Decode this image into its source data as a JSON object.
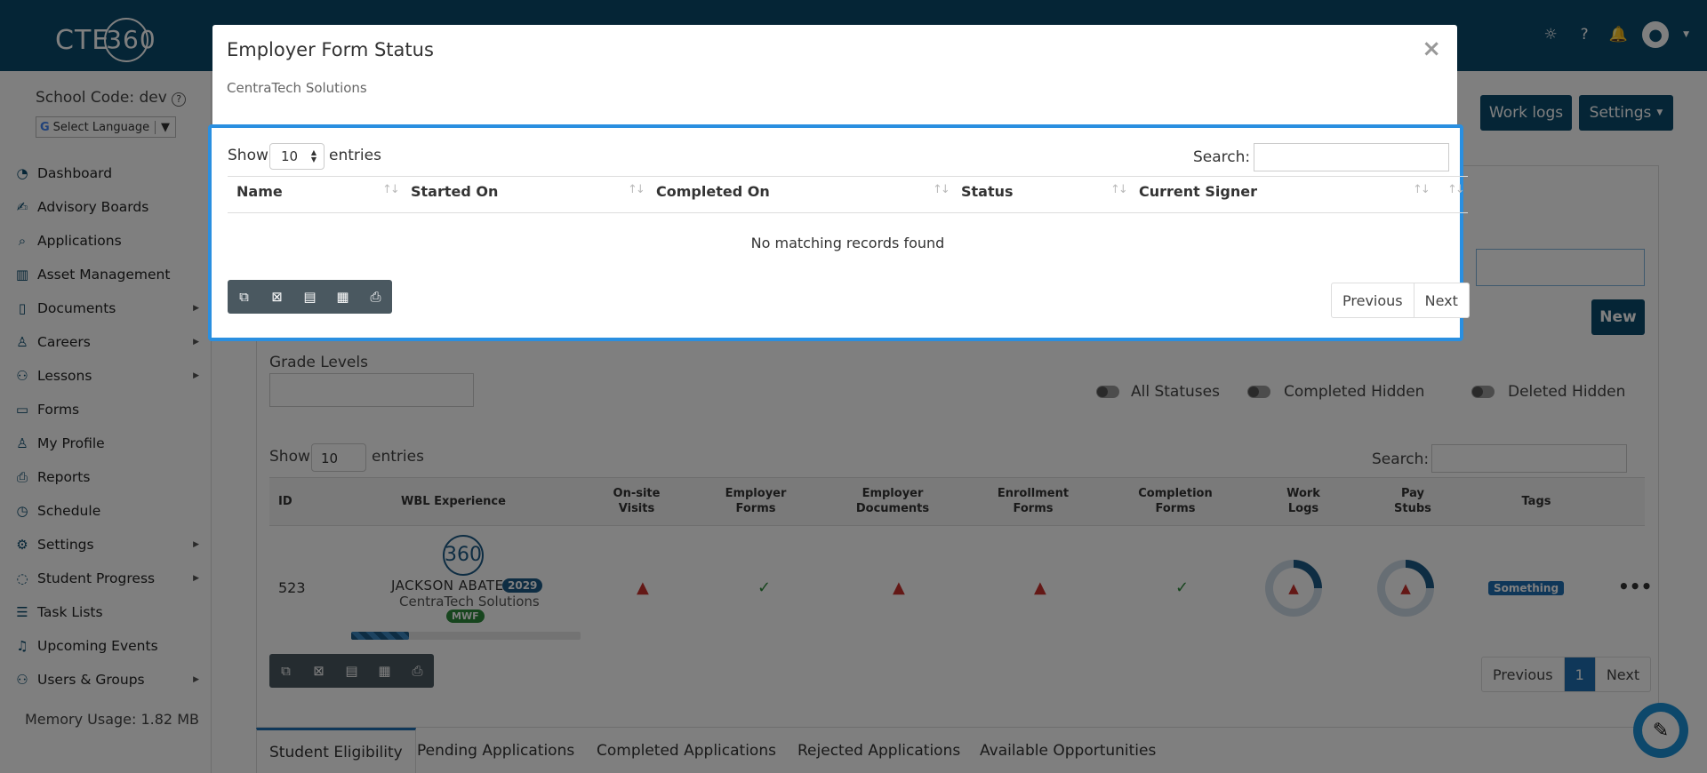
{
  "app": {
    "logo_text": "CTE",
    "logo_ring": "360",
    "header_icons": [
      "lightbulb-icon",
      "help-icon",
      "bell-icon",
      "user-avatar-icon"
    ]
  },
  "sidebar": {
    "school_code": "School Code: dev",
    "language_label": "Select Language",
    "items": [
      {
        "label": "Dashboard",
        "icon": "dashboard-icon",
        "submenu": false
      },
      {
        "label": "Advisory Boards",
        "icon": "handshake-icon",
        "submenu": false
      },
      {
        "label": "Applications",
        "icon": "search-doc-icon",
        "submenu": false
      },
      {
        "label": "Asset Management",
        "icon": "asset-icon",
        "submenu": false
      },
      {
        "label": "Documents",
        "icon": "document-icon",
        "submenu": true
      },
      {
        "label": "Careers",
        "icon": "person-icon",
        "submenu": true
      },
      {
        "label": "Lessons",
        "icon": "people-icon",
        "submenu": true
      },
      {
        "label": "Forms",
        "icon": "form-icon",
        "submenu": false
      },
      {
        "label": "My Profile",
        "icon": "profile-icon",
        "submenu": false
      },
      {
        "label": "Reports",
        "icon": "print-icon",
        "submenu": false
      },
      {
        "label": "Schedule",
        "icon": "clock-icon",
        "submenu": false
      },
      {
        "label": "Settings",
        "icon": "gear-icon",
        "submenu": true
      },
      {
        "label": "Student Progress",
        "icon": "progress-icon",
        "submenu": true
      },
      {
        "label": "Task Lists",
        "icon": "list-icon",
        "submenu": false
      },
      {
        "label": "Upcoming Events",
        "icon": "bell-icon",
        "submenu": false
      },
      {
        "label": "Users & Groups",
        "icon": "users-icon",
        "submenu": true
      }
    ],
    "memory_usage": "Memory Usage: 1.82 MB"
  },
  "background": {
    "work_logs_button": "Work logs",
    "settings_button": "Settings",
    "new_button": "New",
    "grade_levels_label": "Grade Levels",
    "toggles": {
      "all_statuses": "All Statuses",
      "completed_hidden": "Completed Hidden",
      "deleted_hidden": "Deleted Hidden"
    },
    "show_label": "Show",
    "entries_label": "entries",
    "page_size": "10",
    "search_label": "Search:",
    "columns": [
      "ID",
      "WBL Experience",
      "On-site Visits",
      "Employer Forms",
      "Employer Documents",
      "Enrollment Forms",
      "Completion Forms",
      "Work Logs",
      "Pay Stubs",
      "Tags"
    ],
    "row": {
      "id": "523",
      "student_name": "JACKSON ABATE",
      "year_badge": "2029",
      "company": "CentraTech Solutions",
      "schedule_badge": "MWF",
      "avatar_text": "360",
      "progress": 0.25,
      "onsite_visits": "warning",
      "employer_forms": "check",
      "employer_documents": "warning",
      "enrollment_forms": "warning",
      "completion_forms": "check",
      "work_logs_progress": 0.25,
      "pay_stubs_progress": 0.25,
      "tag": "Something"
    },
    "pager": {
      "previous": "Previous",
      "page": "1",
      "next": "Next"
    },
    "tabs": [
      "Student Eligibility",
      "Pending Applications",
      "Completed Applications",
      "Rejected Applications",
      "Available Opportunities"
    ],
    "active_tab": "Student Eligibility"
  },
  "modal": {
    "title": "Employer Form Status",
    "subtitle": "CentraTech Solutions",
    "close_label": "×",
    "show_label": "Show",
    "page_size": "10",
    "entries_label": "entries",
    "search_label": "Search:",
    "search_value": "",
    "columns": [
      "Name",
      "Started On",
      "Completed On",
      "Status",
      "Current Signer"
    ],
    "empty_message": "No matching records found",
    "export_buttons": [
      "copy-icon",
      "excel-icon",
      "csv-icon",
      "pdf-icon",
      "print-icon"
    ],
    "previous_label": "Previous",
    "next_label": "Next"
  }
}
